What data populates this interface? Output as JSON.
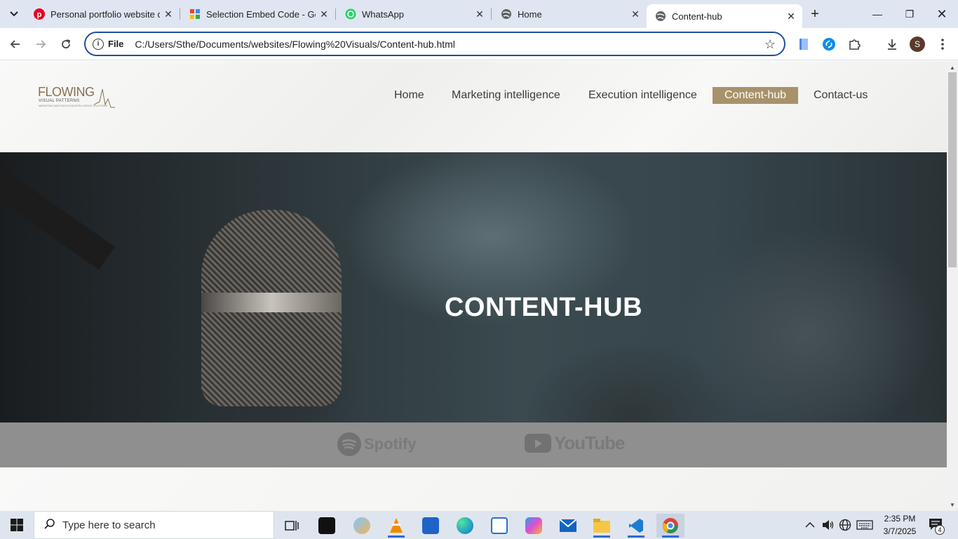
{
  "browser": {
    "tabs": [
      {
        "title": "Personal portfolio website de",
        "icon": "pinterest-icon",
        "color": "#e60023",
        "active": false
      },
      {
        "title": "Selection Embed Code - Goo",
        "icon": "google-apps-icon",
        "color": "#4285f4",
        "active": false
      },
      {
        "title": "WhatsApp",
        "icon": "whatsapp-icon",
        "color": "#25d366",
        "active": false
      },
      {
        "title": "Home",
        "icon": "globe-icon",
        "color": "#5f6368",
        "active": false
      },
      {
        "title": "Content-hub",
        "icon": "globe-icon",
        "color": "#5f6368",
        "active": true
      }
    ],
    "address": {
      "scheme_label": "File",
      "url": "C:/Users/Sthe/Documents/websites/Flowing%20Visuals/Content-hub.html"
    },
    "profile_initial": "S"
  },
  "site": {
    "logo": {
      "main": "FLOWING",
      "sub": "VISUAL PATTERNS",
      "tiny": "MARKETING AND EXECUTION INTELLIGENCE SOLUTIONS"
    },
    "nav": [
      {
        "label": "Home",
        "active": false
      },
      {
        "label": "Marketing intelligence",
        "active": false
      },
      {
        "label": "Execution intelligence",
        "active": false
      },
      {
        "label": "Content-hub",
        "active": true
      },
      {
        "label": "Contact-us",
        "active": false
      }
    ],
    "hero_title": "CONTENT-HUB",
    "platforms": {
      "spotify": "Spotify",
      "youtube": "YouTube"
    },
    "accent_color": "#a8926a"
  },
  "taskbar": {
    "search_placeholder": "Type here to search",
    "time": "2:35 PM",
    "date": "3/7/2025",
    "notification_count": "4"
  }
}
